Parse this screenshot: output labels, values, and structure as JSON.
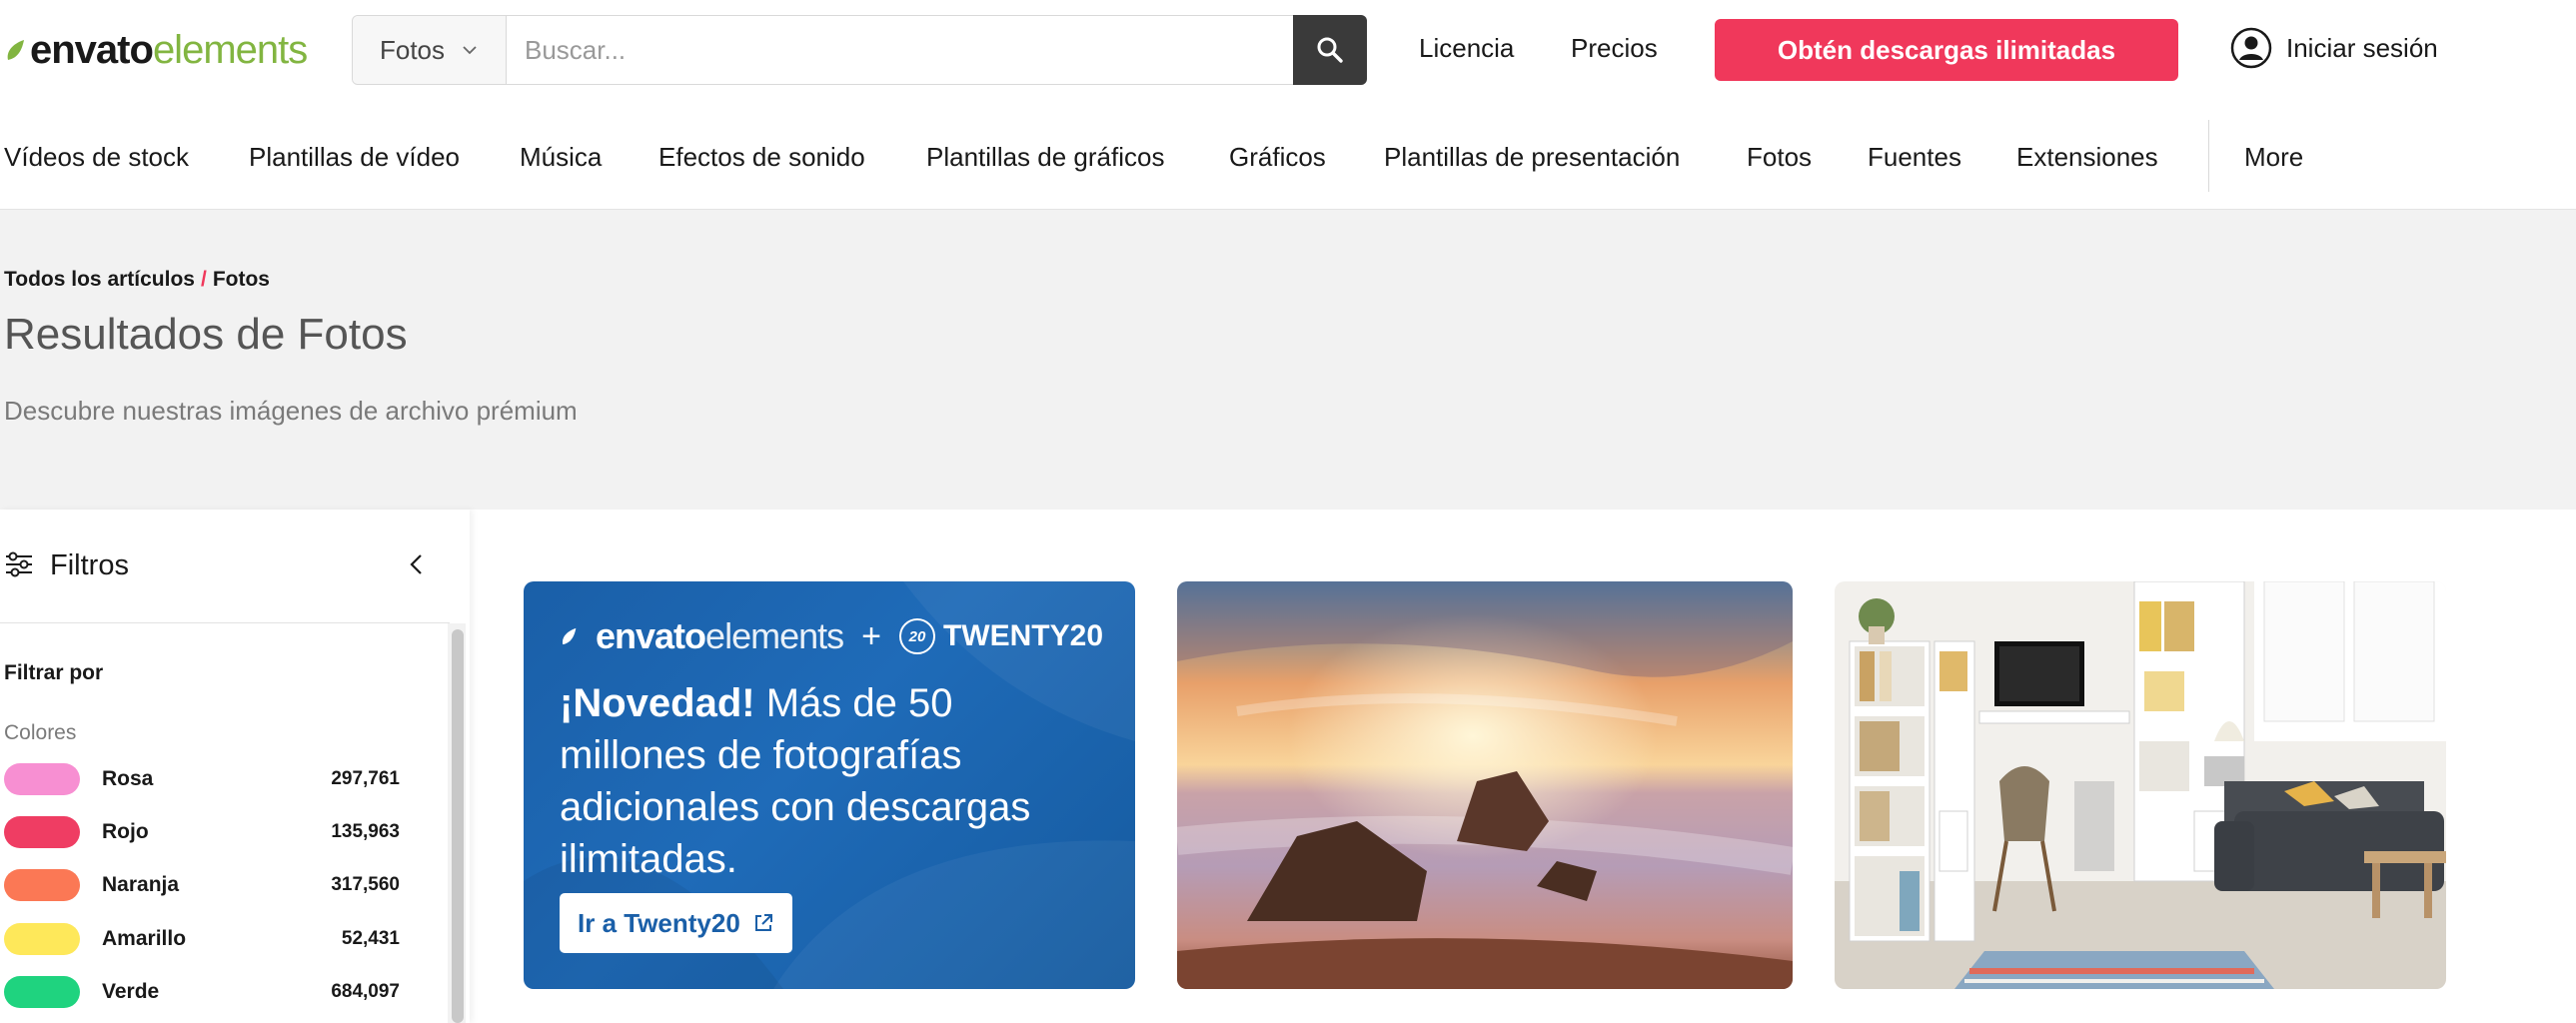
{
  "header": {
    "logo": {
      "word1": "envato",
      "word2": "elements",
      "leaf_color": "#82b541"
    },
    "search": {
      "category": "Fotos",
      "placeholder": "Buscar..."
    },
    "links": {
      "license": "Licencia",
      "pricing": "Precios"
    },
    "cta": "Obtén descargas ilimitadas",
    "signin": "Iniciar sesión",
    "accent_color": "#f0385b"
  },
  "nav": {
    "items": [
      "Vídeos de stock",
      "Plantillas de vídeo",
      "Música",
      "Efectos de sonido",
      "Plantillas de gráficos",
      "Gráficos",
      "Plantillas de presentación",
      "Fotos",
      "Fuentes",
      "Extensiones"
    ],
    "more": "More"
  },
  "breadcrumb": {
    "root": "Todos los artículos",
    "separator": "/",
    "current": "Fotos"
  },
  "page": {
    "title": "Resultados de Fotos",
    "subtitle": "Descubre nuestras imágenes de archivo prémium"
  },
  "filters": {
    "title": "Filtros",
    "filter_by": "Filtrar por",
    "colors_label": "Colores",
    "colors": [
      {
        "name": "Rosa",
        "count": "297,761",
        "color": "#f78fd2"
      },
      {
        "name": "Rojo",
        "count": "135,963",
        "color": "#ef3d63"
      },
      {
        "name": "Naranja",
        "count": "317,560",
        "color": "#fb7855"
      },
      {
        "name": "Amarillo",
        "count": "52,431",
        "color": "#fee85a"
      },
      {
        "name": "Verde",
        "count": "684,097",
        "color": "#1fd37f"
      }
    ]
  },
  "promo": {
    "logo_word1": "envato",
    "logo_word2": "elements",
    "plus": "+",
    "partner_badge": "20",
    "partner": "TWENTY20",
    "headline_bold": "¡Novedad!",
    "headline_rest": "Más de 50 millones de fotografías adicionales con descargas ilimitadas.",
    "button": "Ir a Twenty20",
    "button_icon": "external-link-icon"
  }
}
